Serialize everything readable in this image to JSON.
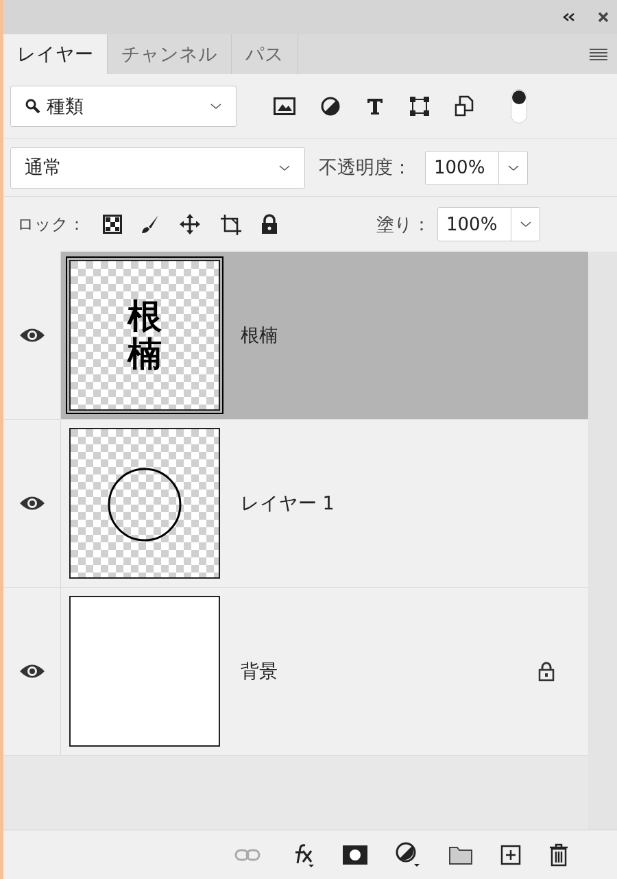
{
  "tabs": [
    {
      "label": "レイヤー",
      "selected": true
    },
    {
      "label": "チャンネル",
      "selected": false
    },
    {
      "label": "パス",
      "selected": false
    }
  ],
  "filter": {
    "value": "種類",
    "toggle_on": true
  },
  "blend_mode": {
    "value": "通常"
  },
  "opacity": {
    "label": "不透明度：",
    "value": "100%"
  },
  "lock": {
    "label": "ロック："
  },
  "fill": {
    "label": "塗り：",
    "value": "100%"
  },
  "layers": [
    {
      "name": "根楠",
      "kind": "text",
      "thumb_text": "根楠",
      "selected": true,
      "visible": true,
      "locked": false
    },
    {
      "name": "レイヤー 1",
      "kind": "circle",
      "selected": false,
      "visible": true,
      "locked": false
    },
    {
      "name": "背景",
      "kind": "background",
      "selected": false,
      "visible": true,
      "locked": true
    }
  ]
}
